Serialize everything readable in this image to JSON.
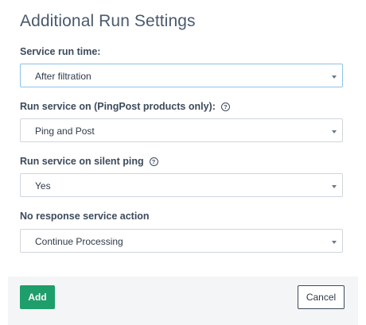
{
  "dialog": {
    "title": "Additional Run Settings"
  },
  "fields": [
    {
      "label": "Service run time:",
      "value": "After filtration",
      "has_help": false
    },
    {
      "label": "Run service on (PingPost products only):",
      "value": "Ping and Post",
      "has_help": true,
      "help_glyph": "?"
    },
    {
      "label": "Run service on silent ping",
      "value": "Yes",
      "has_help": true,
      "help_glyph": "?"
    },
    {
      "label": "No response service action",
      "value": "Continue Processing",
      "has_help": false
    }
  ],
  "footer": {
    "add_label": "Add",
    "cancel_label": "Cancel"
  },
  "colors": {
    "primary_button": "#1e9e6a",
    "focused_border": "#8cc3ea",
    "text": "#3d4a5c"
  },
  "icons": {
    "help": "question-circle-icon",
    "caret": "caret-down-icon"
  }
}
